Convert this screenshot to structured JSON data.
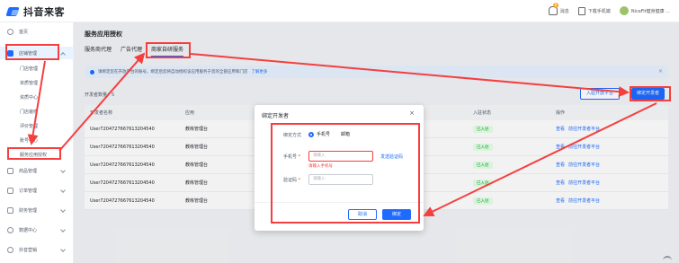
{
  "app": {
    "logo_text": "抖音来客"
  },
  "topbar": {
    "notif_count": "8",
    "notif_label": "消息",
    "download_label": "下载手机端",
    "account_name": "NiceFit健身健康 ..."
  },
  "sidebar": {
    "home": "首页",
    "store_manage": "店铺管理",
    "store_subitems": [
      "门店管理",
      "资质管理",
      "资质中心",
      "门店装修",
      "评价管理",
      "账号中心",
      "服务应用授权"
    ],
    "products": "商品管理",
    "orders": "订单管理",
    "finance": "财务管理",
    "data": "数据中心",
    "douyin_marketing": "抖音营销"
  },
  "main": {
    "page_title": "服务应用授权",
    "tabs": [
      "服务商代理",
      "广告代理",
      "商家自研服务"
    ],
    "alert_text": "请绑定您在开放平台的账号，绑定后您将自动授权该应用服务于您的全部应用和门店",
    "alert_link": "了解更多",
    "count_text": "开发者数量：5",
    "btn_enter_platform": "入驻开放平台",
    "btn_bind_dev": "绑定开发者",
    "table_headers": [
      "开发者名称",
      "应用",
      "",
      "入驻状态",
      "操作"
    ],
    "rows": [
      {
        "name": "User7204727667613204540",
        "app": "教练管理台",
        "status": "已入驻"
      },
      {
        "name": "User7204727667613204540",
        "app": "教练管理台",
        "status": "已入驻"
      },
      {
        "name": "User7204727667613204540",
        "app": "教练管理台",
        "status": "已入驻"
      },
      {
        "name": "User7204727667613204540",
        "app": "教练管理台",
        "status": "已入驻"
      },
      {
        "name": "User7204727667613204540",
        "app": "教练管理台",
        "status": "已入驻"
      }
    ],
    "op_view": "查看",
    "op_goto": "前往开发者平台"
  },
  "modal": {
    "title": "绑定开发者",
    "bind_method_label": "绑定方式",
    "option_phone": "手机号",
    "option_email": "邮箱",
    "phone_label": "手机号",
    "phone_placeholder": "请输入",
    "phone_error": "请输入手机号",
    "send_code": "发送验证码",
    "code_label": "验证码",
    "code_placeholder": "请输入",
    "cancel": "取消",
    "confirm": "绑定"
  },
  "colors": {
    "accent": "#1e6bff",
    "annotation": "#f53f3f",
    "success": "#00b42a"
  }
}
